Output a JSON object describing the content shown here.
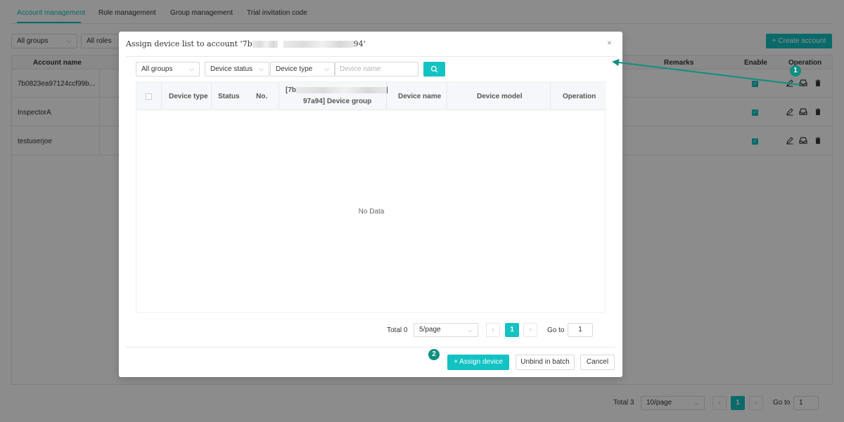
{
  "tabs": [
    "Account management",
    "Role management",
    "Group management",
    "Trial invitation code"
  ],
  "filters": {
    "groups": "All groups",
    "roles": "All roles"
  },
  "create_account": "+ Create account",
  "accounts_table": {
    "headers": {
      "name": "Account name",
      "remarks": "Remarks",
      "enable": "Enable",
      "operation": "Operation"
    },
    "rows": [
      "7b0823ea97124ccf99b...",
      "InspectorA",
      "testuserjoe"
    ]
  },
  "bg_pager": {
    "total": "Total 3",
    "page_size": "10/page",
    "current": "1",
    "goto_label": "Go to",
    "goto_value": "1"
  },
  "modal": {
    "title_prefix": "Assign device list to account '7b",
    "title_suffix": "94'",
    "close": "×",
    "filters": {
      "groups": "All groups",
      "status": "Device status",
      "type": "Device type",
      "name_placeholder": "Device name"
    },
    "headers": {
      "device_type": "Device type",
      "status": "Status",
      "no": "No.",
      "group_top": "[7b",
      "group_bottom": "97a94] Device group",
      "device_name": "Device name",
      "device_model": "Device model",
      "operation": "Operation"
    },
    "no_data": "No Data",
    "pager": {
      "total": "Total 0",
      "page_size": "5/page",
      "current": "1",
      "goto_label": "Go to",
      "goto_value": "1"
    },
    "buttons": {
      "assign": "+ Assign device",
      "unbind": "Unbind in batch",
      "cancel": "Cancel"
    }
  },
  "annotations": {
    "badge1": "1",
    "badge2": "2",
    "color": "#0f8e80"
  },
  "colors": {
    "accent": "#13c2c2"
  },
  "icons": [
    "edit-icon",
    "inbox-icon",
    "trash-icon",
    "search-icon",
    "close-icon",
    "chevron-down-icon",
    "chevron-left-icon",
    "chevron-right-icon"
  ]
}
